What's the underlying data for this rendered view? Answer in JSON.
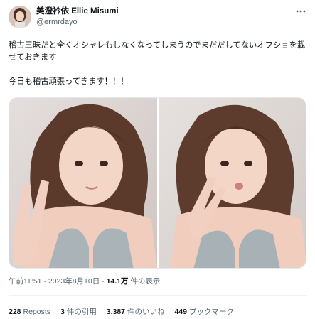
{
  "author": {
    "display_name": "美澄衿依 Ellie Misumi",
    "handle": "@ermrdayo",
    "avatar_icon": "profile-avatar"
  },
  "more_icon": "more-horizontal-icon",
  "tweet": {
    "text": "稽古三昧だと全くオシャレもしなくなってしまうのでまだだしてないオフショを載せておきます\n\n今日も稽古頑張ってきます！！！"
  },
  "media": {
    "photos": [
      "photo-1",
      "photo-2"
    ]
  },
  "meta": {
    "time": "午前11:51",
    "sep1": "·",
    "date": "2023年8月10日",
    "sep2": "·",
    "views_count": "14.1万",
    "views_label": "件の表示"
  },
  "stats": {
    "reposts": {
      "count": "228",
      "label": "Reposts"
    },
    "quotes": {
      "count": "3",
      "label": "件の引用"
    },
    "likes": {
      "count": "3,387",
      "label": "件のいいね"
    },
    "bookmarks": {
      "count": "449",
      "label": "ブックマーク"
    }
  },
  "colors": {
    "text": "#0f1419",
    "secondary": "#536471",
    "divider": "#eff3f4"
  }
}
